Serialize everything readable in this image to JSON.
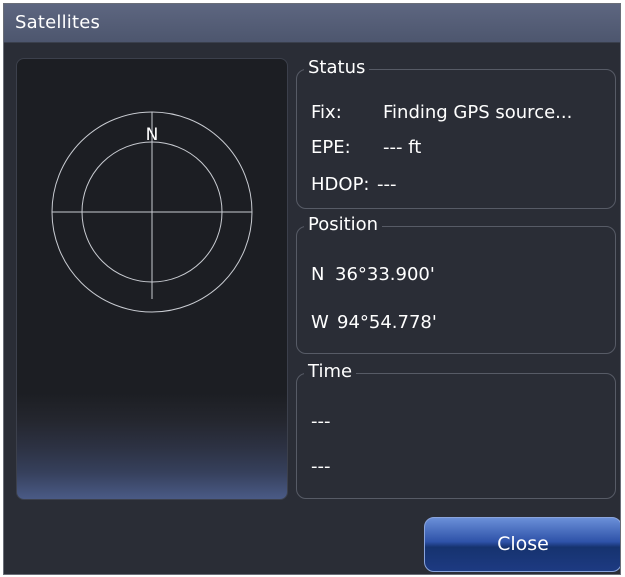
{
  "window": {
    "title": "Satellites"
  },
  "sky_view": {
    "north_label": "N"
  },
  "status": {
    "title": "Status",
    "fix_label": "Fix:",
    "fix_value": "Finding GPS source...",
    "epe_label": "EPE:",
    "epe_value": "--- ft",
    "hdop_label": "HDOP:",
    "hdop_value": "---"
  },
  "position": {
    "title": "Position",
    "lat_hemisphere": "N",
    "lat_value": "36°33.900'",
    "lon_hemisphere": "W",
    "lon_value": "94°54.778'"
  },
  "time": {
    "title": "Time",
    "line1": "---",
    "line2": "---"
  },
  "buttons": {
    "close_label": "Close"
  },
  "colors": {
    "dialog_bg": "#2a2d36",
    "titlebar": "#555e77",
    "button_accent": "#2e52a8"
  }
}
